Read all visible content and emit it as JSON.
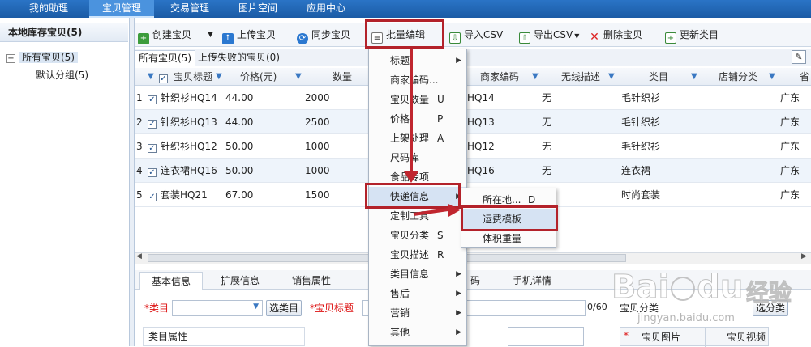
{
  "topnav": {
    "tabs": [
      {
        "label": "我的助理",
        "active": false
      },
      {
        "label": "宝贝管理",
        "active": true
      },
      {
        "label": "交易管理",
        "active": false
      },
      {
        "label": "图片空间",
        "active": false
      },
      {
        "label": "应用中心",
        "active": false
      }
    ]
  },
  "left": {
    "title": "本地库存宝贝(5)",
    "tree_root": "所有宝贝(5)",
    "tree_root_toggle": "−",
    "tree_child": "默认分组(5)"
  },
  "toolbar": {
    "create": "创建宝贝",
    "upload": "上传宝贝",
    "sync": "同步宝贝",
    "batch_edit": "批量编辑",
    "import_csv": "导入CSV",
    "export_csv": "导出CSV",
    "delete": "删除宝贝",
    "update_category": "更新类目"
  },
  "subtabs": {
    "all": "所有宝贝(5)",
    "failed": "上传失败的宝贝(0)"
  },
  "grid": {
    "columns": [
      "宝贝标题",
      "价格(元)",
      "数量",
      "商家编码",
      "无线描述",
      "类目",
      "店铺分类",
      "省"
    ],
    "rows": [
      {
        "idx": "1",
        "title": "针织衫HQ14",
        "price": "44.00",
        "qty": "2000",
        "code": "HQ14",
        "mobile": "无",
        "cat": "毛针织衫",
        "prov": "广东"
      },
      {
        "idx": "2",
        "title": "针织衫HQ13",
        "price": "44.00",
        "qty": "2500",
        "code": "HQ13",
        "mobile": "无",
        "cat": "毛针织衫",
        "prov": "广东"
      },
      {
        "idx": "3",
        "title": "针织衫HQ12",
        "price": "50.00",
        "qty": "1000",
        "code": "HQ12",
        "mobile": "无",
        "cat": "毛针织衫",
        "prov": "广东"
      },
      {
        "idx": "4",
        "title": "连衣裙HQ16",
        "price": "50.00",
        "qty": "1000",
        "code": "HQ16",
        "mobile": "无",
        "cat": "连衣裙",
        "prov": "广东"
      },
      {
        "idx": "5",
        "title": "套装HQ21",
        "price": "67.00",
        "qty": "1500",
        "code": "",
        "mobile": "",
        "cat": "时尚套装",
        "prov": "广东"
      }
    ]
  },
  "menu": {
    "items": [
      {
        "label": "标题",
        "shortcut": "",
        "sub": true
      },
      {
        "label": "商家编码...",
        "shortcut": "",
        "sub": false
      },
      {
        "label": "宝贝数量",
        "shortcut": "U",
        "sub": false
      },
      {
        "label": "价格",
        "shortcut": "P",
        "sub": false
      },
      {
        "label": "上架处理",
        "shortcut": "A",
        "sub": false
      },
      {
        "label": "尺码库",
        "shortcut": "",
        "sub": false
      },
      {
        "label": "食品专项",
        "shortcut": "",
        "sub": false
      },
      {
        "label": "快递信息",
        "shortcut": "",
        "sub": true
      },
      {
        "label": "定制工具",
        "shortcut": "",
        "sub": false
      },
      {
        "label": "宝贝分类",
        "shortcut": "S",
        "sub": false
      },
      {
        "label": "宝贝描述",
        "shortcut": "R",
        "sub": false
      },
      {
        "label": "类目信息",
        "shortcut": "",
        "sub": true
      },
      {
        "label": "售后",
        "shortcut": "",
        "sub": true
      },
      {
        "label": "营销",
        "shortcut": "",
        "sub": true
      },
      {
        "label": "其他",
        "shortcut": "",
        "sub": true
      }
    ],
    "submenu": [
      {
        "label": "所在地...",
        "shortcut": "D"
      },
      {
        "label": "运费模板",
        "shortcut": ""
      },
      {
        "label": "体积重量",
        "shortcut": ""
      }
    ]
  },
  "bottom": {
    "tabs": [
      "基本信息",
      "扩展信息",
      "销售属性",
      "码",
      "手机详情"
    ],
    "category_label": "*类目",
    "select_category": "选类目",
    "title_label": "*宝贝标题",
    "counter": "0/60",
    "shop_category": "宝贝分类",
    "select_shop_category": "选分类",
    "category_props": "类目属性",
    "pictures": "宝贝图片",
    "videos": "宝贝视频",
    "asterisk": "*"
  },
  "watermark": {
    "brand": "Bai",
    "brand_suffix": "du",
    "cn": "经验",
    "url": "jingyan.baidu.com"
  },
  "colors": {
    "nav": "#1b5ba5",
    "highlight": "#b3222a",
    "menu_hover": "#d6e3f3"
  }
}
